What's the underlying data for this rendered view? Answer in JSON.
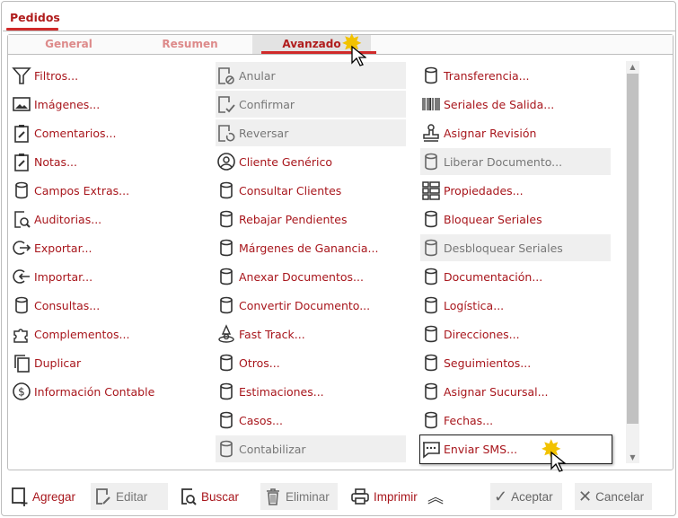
{
  "window": {
    "tab": "Pedidos"
  },
  "subtabs": [
    {
      "label": "General"
    },
    {
      "label": "Resumen"
    },
    {
      "label": "Avanzado",
      "active": true
    }
  ],
  "columns": [
    [
      {
        "label": "Filtros...",
        "icon": "filter-icon"
      },
      {
        "label": "Imágenes...",
        "icon": "image-icon"
      },
      {
        "label": "Comentarios...",
        "icon": "clipboard-edit-icon"
      },
      {
        "label": "Notas...",
        "icon": "clipboard-edit-icon"
      },
      {
        "label": "Campos Extras...",
        "icon": "database-icon"
      },
      {
        "label": "Auditorias...",
        "icon": "audit-icon"
      },
      {
        "label": "Exportar...",
        "icon": "export-icon"
      },
      {
        "label": "Importar...",
        "icon": "import-icon"
      },
      {
        "label": "Consultas...",
        "icon": "database-icon"
      },
      {
        "label": "Complementos...",
        "icon": "puzzle-icon"
      },
      {
        "label": "Duplicar",
        "icon": "copy-icon"
      },
      {
        "label": "Información Contable",
        "icon": "dollar-icon"
      }
    ],
    [
      {
        "label": "Anular",
        "icon": "document-cancel-icon",
        "disabled": true
      },
      {
        "label": "Confirmar",
        "icon": "document-check-icon",
        "disabled": true
      },
      {
        "label": "Reversar",
        "icon": "document-undo-icon",
        "disabled": true
      },
      {
        "label": "Cliente Genérico",
        "icon": "user-circle-icon"
      },
      {
        "label": "Consultar Clientes",
        "icon": "database-icon"
      },
      {
        "label": "Rebajar Pendientes",
        "icon": "database-icon"
      },
      {
        "label": "Márgenes de Ganancia...",
        "icon": "database-icon"
      },
      {
        "label": "Anexar Documentos...",
        "icon": "database-icon"
      },
      {
        "label": "Convertir Documento...",
        "icon": "database-icon"
      },
      {
        "label": "Fast Track...",
        "icon": "wizard-icon"
      },
      {
        "label": "Otros...",
        "icon": "database-icon"
      },
      {
        "label": "Estimaciones...",
        "icon": "database-icon"
      },
      {
        "label": "Casos...",
        "icon": "database-icon"
      },
      {
        "label": "Contabilizar",
        "icon": "database-icon",
        "disabled": true
      }
    ],
    [
      {
        "label": "Transferencia...",
        "icon": "database-icon"
      },
      {
        "label": "Seriales de Salida...",
        "icon": "barcode-icon"
      },
      {
        "label": "Asignar Revisión",
        "icon": "stamp-icon"
      },
      {
        "label": "Liberar Documento...",
        "icon": "database-icon",
        "disabled": true
      },
      {
        "label": "Propiedades...",
        "icon": "properties-icon"
      },
      {
        "label": "Bloquear Seriales",
        "icon": "database-icon"
      },
      {
        "label": "Desbloquear Seriales",
        "icon": "database-icon",
        "disabled": true
      },
      {
        "label": "Documentación...",
        "icon": "database-icon"
      },
      {
        "label": "Logística...",
        "icon": "database-icon"
      },
      {
        "label": "Direcciones...",
        "icon": "database-icon"
      },
      {
        "label": "Seguimientos...",
        "icon": "database-icon"
      },
      {
        "label": "Asignar Sucursal...",
        "icon": "database-icon"
      },
      {
        "label": "Fechas...",
        "icon": "database-icon"
      },
      {
        "label": "Enviar SMS...",
        "icon": "message-icon",
        "highlighted": true
      }
    ]
  ],
  "footer": {
    "add": "Agregar",
    "edit": "Editar",
    "search": "Buscar",
    "delete": "Eliminar",
    "print": "Imprimir",
    "accept": "Aceptar",
    "cancel": "Cancelar"
  },
  "colors": {
    "accent": "#d02a2a",
    "text": "#a8161c",
    "disabled_bg": "#efefef"
  }
}
